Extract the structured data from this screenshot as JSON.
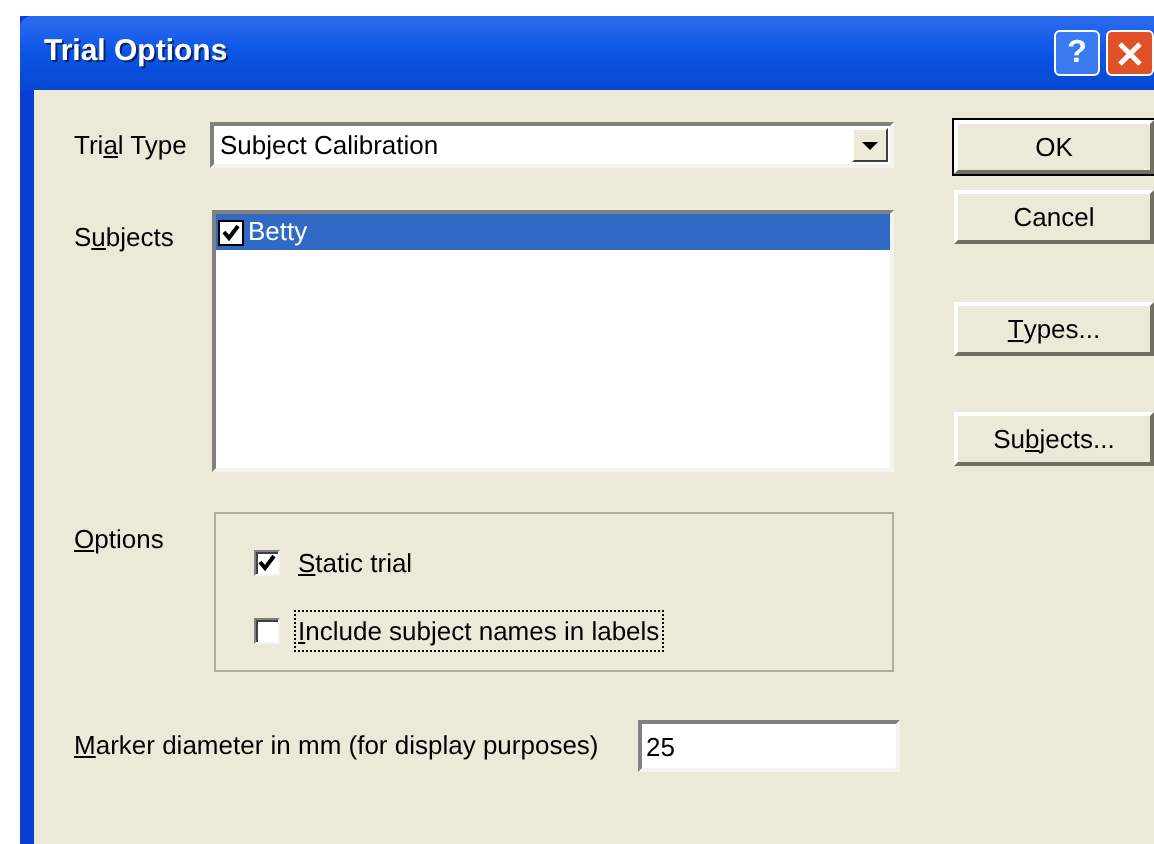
{
  "window": {
    "title": "Trial Options",
    "title_buttons": [
      {
        "kind": "help",
        "label": "?"
      },
      {
        "kind": "close"
      }
    ]
  },
  "trial_type": {
    "label_parts": {
      "pre": "Tri",
      "key": "a",
      "post": "l Type"
    },
    "value": "Subject Calibration"
  },
  "subjects": {
    "label_parts": {
      "pre": "S",
      "key": "u",
      "post": "bjects"
    },
    "items": [
      {
        "name": "Betty",
        "checked": true,
        "selected": true
      }
    ]
  },
  "options": {
    "label_parts": {
      "key": "O",
      "post": "ptions"
    },
    "items": [
      {
        "label_parts": {
          "key": "S",
          "post": "tatic trial"
        },
        "checked": true,
        "focused": false
      },
      {
        "label_parts": {
          "key": "I",
          "post": "nclude subject names in labels"
        },
        "checked": false,
        "focused": true
      }
    ]
  },
  "marker_diameter": {
    "label_parts": {
      "key": "M",
      "post": "arker diameter in mm (for display purposes)"
    },
    "value": "25"
  },
  "buttons": [
    {
      "label_parts": {
        "post": "OK"
      },
      "default": true
    },
    {
      "label_parts": {
        "post": "Cancel"
      },
      "default": false
    },
    {
      "label_parts": {
        "key": "T",
        "post": "ypes..."
      },
      "default": false
    },
    {
      "label_parts": {
        "pre": "Su",
        "key": "b",
        "post": "jects..."
      },
      "default": false
    }
  ]
}
